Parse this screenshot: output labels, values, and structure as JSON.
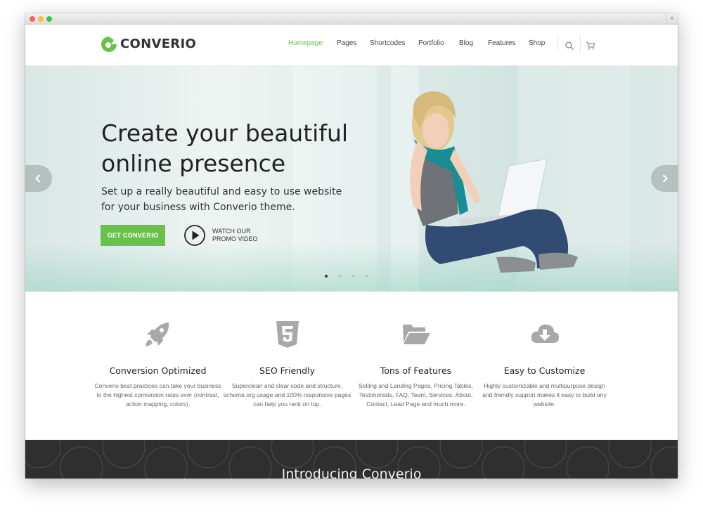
{
  "header": {
    "logo_text": "CONVERIO",
    "nav": [
      "Homepage",
      "Pages",
      "Shortcodes",
      "Portfolio",
      "Blog",
      "Features",
      "Shop"
    ],
    "active_nav": "Homepage",
    "search_icon": "search-icon",
    "cart_icon": "cart-icon"
  },
  "hero": {
    "title": "Create your beautiful online presence",
    "subtitle": "Set up a really beautiful and easy to use website for your business with Converio theme.",
    "cta_label": "GET CONVERIO",
    "promo_label": "WATCH OUR PROMO VIDEO",
    "slides_count": 4,
    "active_slide": 1
  },
  "features": [
    {
      "icon": "rocket-icon",
      "title": "Conversion Optimized",
      "desc": "Converio best practices can take your business to the highest conversion rates ever (contrast, action mapping, colors)."
    },
    {
      "icon": "html5-icon",
      "title": "SEO Friendly",
      "desc": "Superclean and clear code and structure, schema.org usage and 100% responsive pages can help you rank on top."
    },
    {
      "icon": "folder-open-icon",
      "title": "Tons of Features",
      "desc": "Selling and Landing Pages, Pricing Tables, Testimonials, FAQ, Team, Services, About, Contact, Lead Page and much more."
    },
    {
      "icon": "cloud-download-icon",
      "title": "Easy to Customize",
      "desc": "Highly customizable and multipurpose design and friendly support makes it easy to build any website."
    }
  ],
  "intro": {
    "title": "Introducing Converio"
  },
  "colors": {
    "accent": "#69c04b",
    "dark_section": "#2f2f2f",
    "icon_gray": "#a8a8a8"
  }
}
